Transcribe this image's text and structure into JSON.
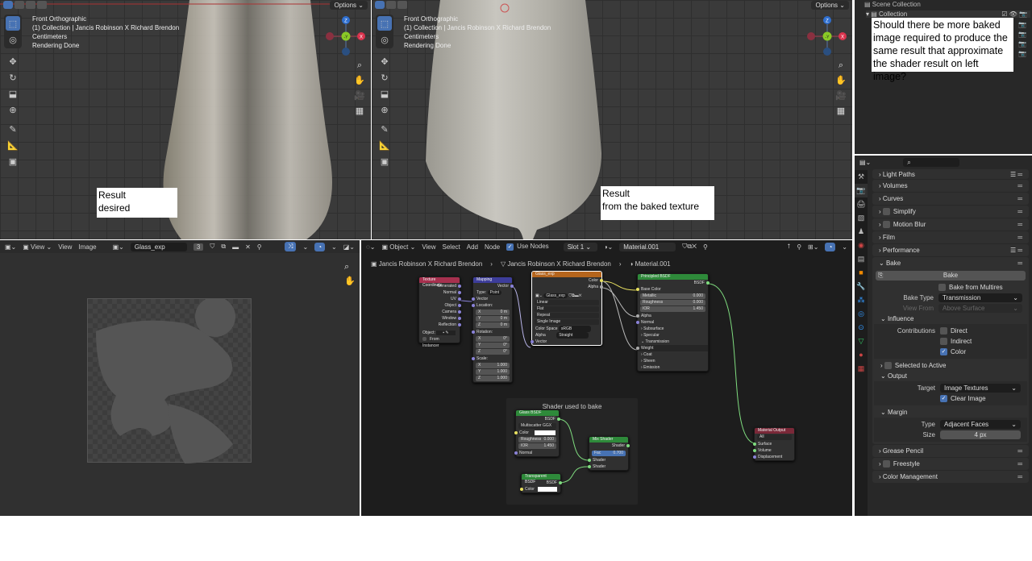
{
  "viewport_left": {
    "options": "Options",
    "info": [
      "Front Orthographic",
      "(1) Collection | Jancis Robinson X Richard Brendon",
      "Centimeters",
      "Rendering Done"
    ],
    "note": [
      "Result",
      "desired"
    ]
  },
  "viewport_right": {
    "options": "Options",
    "info": [
      "Front Orthographic",
      "(1) Collection | Jancis Robinson X Richard Brendon",
      "Centimeters",
      "Rendering Done"
    ],
    "note": [
      "Result",
      "from the baked texture"
    ]
  },
  "gizmo": {
    "z": "Z",
    "y": "-Y",
    "x": "X"
  },
  "outliner": {
    "scene_collection": "Scene Collection",
    "collection": "Collection",
    "question": "Should there be more baked image required to produce the same result that approximate the shader result on left image?"
  },
  "image_editor": {
    "menus": [
      "View",
      "View",
      "Image"
    ],
    "image_name": "Glass_exp",
    "users": "3"
  },
  "node_editor": {
    "mode": "Object",
    "menus": [
      "View",
      "Select",
      "Add",
      "Node"
    ],
    "use_nodes": "Use Nodes",
    "slot": "Slot 1",
    "material": "Material.001",
    "breadcrumb": [
      "Jancis Robinson X Richard Brendon",
      "Jancis Robinson X Richard Brendon",
      "Material.001"
    ],
    "frame_label": "Shader used to bake",
    "nodes": {
      "texcoord": {
        "title": "Texture Coordinate",
        "outputs": [
          "Generated",
          "Normal",
          "UV",
          "Object",
          "Camera",
          "Window",
          "Reflection"
        ],
        "object": "Object:",
        "from_instancer": "From Instancer"
      },
      "mapping": {
        "title": "Mapping",
        "out": "Vector",
        "type_label": "Type:",
        "type": "Point",
        "vector": "Vector",
        "location": "Location:",
        "loc": [
          "0 m",
          "0 m",
          "0 m"
        ],
        "rotation": "Rotation:",
        "rot": [
          "0°",
          "0°",
          "0°"
        ],
        "scale": "Scale:",
        "scl": [
          "1.000",
          "1.000",
          "1.000"
        ],
        "axes": [
          "X",
          "Y",
          "Z"
        ]
      },
      "image": {
        "title": "Glass_exp",
        "outputs": [
          "Color",
          "Alpha"
        ],
        "image": "Glass_exp",
        "interp": "Linear",
        "proj": "Flat",
        "ext": "Repeat",
        "source": "Single Image",
        "cs_label": "Color Space",
        "cs": "sRGB",
        "alpha_label": "Alpha",
        "alpha": "Straight",
        "vector": "Vector"
      },
      "principled": {
        "title": "Principled BSDF",
        "out": "BSDF",
        "base_color": "Base Color",
        "metallic": "Metallic",
        "metallic_v": "0.000",
        "roughness": "Roughness",
        "roughness_v": "0.000",
        "ior": "IOR",
        "ior_v": "1.450",
        "alpha": "Alpha",
        "normal": "Normal",
        "subsurface": "Subsurface",
        "specular": "Specular",
        "transmission": "Transmission",
        "weight": "Weight",
        "coat": "Coat",
        "sheen": "Sheen",
        "emission": "Emission"
      },
      "glass": {
        "title": "Glass BSDF",
        "out": "BSDF",
        "dist": "Multiscatter GGX",
        "color": "Color",
        "roughness": "Roughness",
        "roughness_v": "0.000",
        "ior": "IOR",
        "ior_v": "1.450",
        "normal": "Normal"
      },
      "mix": {
        "title": "Mix Shader",
        "out": "Shader",
        "fac": "Fac",
        "fac_v": "0.700",
        "shader1": "Shader",
        "shader2": "Shader"
      },
      "transparent": {
        "title": "Transparent BSDF",
        "out": "BSDF",
        "color": "Color"
      },
      "output": {
        "title": "Material Output",
        "target": "All",
        "surface": "Surface",
        "volume": "Volume",
        "displacement": "Displacement"
      }
    }
  },
  "properties": {
    "panels_top": [
      "Light Paths",
      "Volumes",
      "Curves",
      "Simplify",
      "Motion Blur",
      "Film",
      "Performance"
    ],
    "bake": "Bake",
    "bake_button": "Bake",
    "bake_multires": "Bake from Multires",
    "bake_type_label": "Bake Type",
    "bake_type": "Transmission",
    "view_from_label": "View From",
    "view_from": "Above Surface",
    "influence": "Influence",
    "contributions": "Contributions",
    "direct": "Direct",
    "indirect": "Indirect",
    "color": "Color",
    "selected_to_active": "Selected to Active",
    "output": "Output",
    "target_label": "Target",
    "target": "Image Textures",
    "clear_image": "Clear Image",
    "margin": "Margin",
    "type_label": "Type",
    "type": "Adjacent Faces",
    "size_label": "Size",
    "size": "4 px",
    "panels_bottom": [
      "Grease Pencil",
      "Freestyle",
      "Color Management"
    ]
  },
  "colors": {
    "accent": "#4772b3",
    "shader_node": "#2e8a3a",
    "texture_node": "#b5651d",
    "input_node": "#a6304e",
    "vector_node": "#3d3d9a",
    "output_node": "#7a2838"
  }
}
